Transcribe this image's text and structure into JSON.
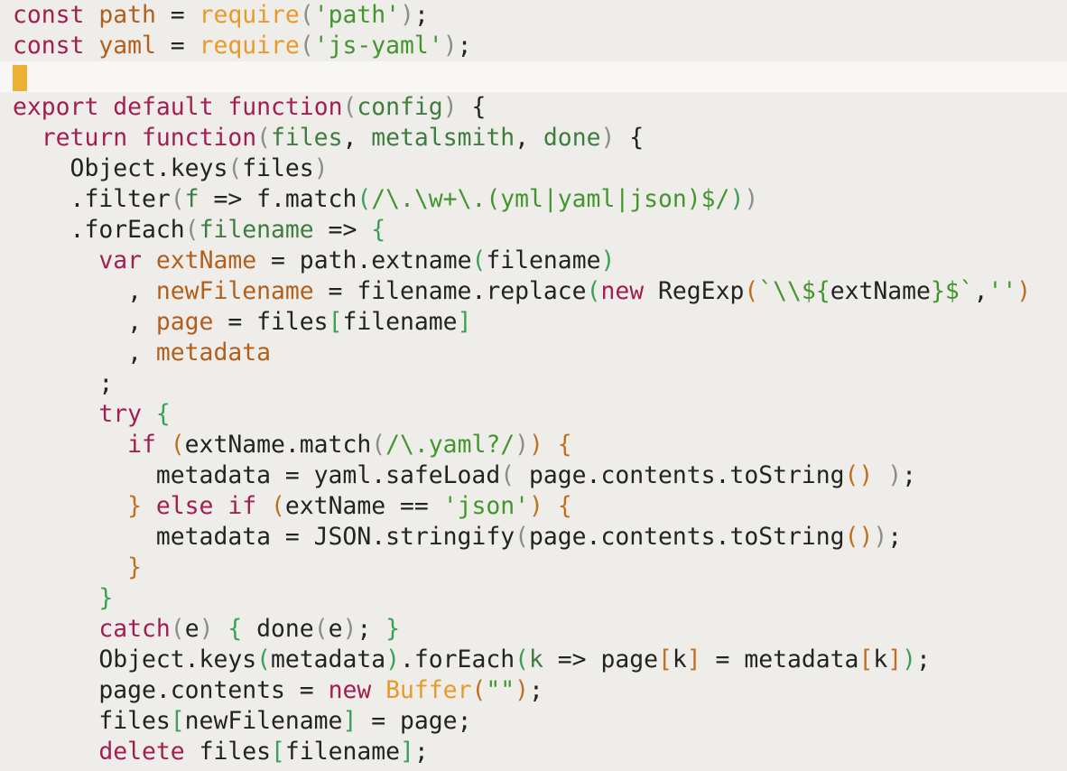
{
  "editor": {
    "cursor_line": 3,
    "colors": {
      "background": "#efedea",
      "current_line": "#f8f7f5",
      "cursor": "#eeb032",
      "keyword": "#a21e52",
      "declaration": "#b15f1c",
      "function_call": "#e89a29",
      "string": "#42962d",
      "parameter": "#3e7d3d",
      "text": "#232323",
      "paren_gray": "#8c8c8c",
      "paren_green": "#3aa055",
      "paren_orange": "#c06f1e"
    },
    "lines": [
      [
        [
          "kw",
          "const"
        ],
        [
          "txt",
          " "
        ],
        [
          "def",
          "path"
        ],
        [
          "txt",
          " = "
        ],
        [
          "fn",
          "require"
        ],
        [
          "pg",
          "("
        ],
        [
          "str",
          "'path'"
        ],
        [
          "pg",
          ")"
        ],
        [
          "txt",
          ";"
        ]
      ],
      [
        [
          "kw",
          "const"
        ],
        [
          "txt",
          " "
        ],
        [
          "def",
          "yaml"
        ],
        [
          "txt",
          " = "
        ],
        [
          "fn",
          "require"
        ],
        [
          "pg",
          "("
        ],
        [
          "str",
          "'js-yaml'"
        ],
        [
          "pg",
          ")"
        ],
        [
          "txt",
          ";"
        ]
      ],
      [],
      [
        [
          "kw",
          "export"
        ],
        [
          "txt",
          " "
        ],
        [
          "kw",
          "default"
        ],
        [
          "txt",
          " "
        ],
        [
          "kw",
          "function"
        ],
        [
          "pg",
          "("
        ],
        [
          "prm",
          "config"
        ],
        [
          "pg",
          ")"
        ],
        [
          "txt",
          " "
        ],
        [
          "pun",
          "{"
        ]
      ],
      [
        [
          "txt",
          "  "
        ],
        [
          "kw",
          "return"
        ],
        [
          "txt",
          " "
        ],
        [
          "kw",
          "function"
        ],
        [
          "pg",
          "("
        ],
        [
          "prm",
          "files"
        ],
        [
          "txt",
          ", "
        ],
        [
          "prm",
          "metalsmith"
        ],
        [
          "txt",
          ", "
        ],
        [
          "prm",
          "done"
        ],
        [
          "pg",
          ")"
        ],
        [
          "txt",
          " "
        ],
        [
          "pun",
          "{"
        ]
      ],
      [
        [
          "txt",
          "    Object.keys"
        ],
        [
          "pg",
          "("
        ],
        [
          "txt",
          "files"
        ],
        [
          "pg",
          ")"
        ]
      ],
      [
        [
          "txt",
          "    .filter"
        ],
        [
          "pg",
          "("
        ],
        [
          "prm",
          "f"
        ],
        [
          "txt",
          " => f.match"
        ],
        [
          "pgr",
          "("
        ],
        [
          "str",
          "/\\.\\w+\\.(yml|yaml|json)$/"
        ],
        [
          "pgr",
          ")"
        ],
        [
          "pg",
          ")"
        ]
      ],
      [
        [
          "txt",
          "    .forEach"
        ],
        [
          "pg",
          "("
        ],
        [
          "prm",
          "filename"
        ],
        [
          "txt",
          " => "
        ],
        [
          "pgr",
          "{"
        ]
      ],
      [
        [
          "txt",
          "      "
        ],
        [
          "kw",
          "var"
        ],
        [
          "txt",
          " "
        ],
        [
          "def",
          "extName"
        ],
        [
          "txt",
          " = path.extname"
        ],
        [
          "pgr",
          "("
        ],
        [
          "txt",
          "filename"
        ],
        [
          "pgr",
          ")"
        ]
      ],
      [
        [
          "txt",
          "        , "
        ],
        [
          "def",
          "newFilename"
        ],
        [
          "txt",
          " = filename.replace"
        ],
        [
          "pgr",
          "("
        ],
        [
          "kw",
          "new"
        ],
        [
          "txt",
          " RegExp"
        ],
        [
          "por",
          "("
        ],
        [
          "str",
          "`\\\\${"
        ],
        [
          "txt",
          "extName"
        ],
        [
          "str",
          "}$`"
        ],
        [
          "txt",
          ","
        ],
        [
          "str",
          "''"
        ],
        [
          "por",
          ")"
        ]
      ],
      [
        [
          "txt",
          "        , "
        ],
        [
          "def",
          "page"
        ],
        [
          "txt",
          " = files"
        ],
        [
          "pgr",
          "["
        ],
        [
          "txt",
          "filename"
        ],
        [
          "pgr",
          "]"
        ]
      ],
      [
        [
          "txt",
          "        , "
        ],
        [
          "def",
          "metadata"
        ]
      ],
      [
        [
          "txt",
          "      ;"
        ]
      ],
      [
        [
          "txt",
          "      "
        ],
        [
          "kw",
          "try"
        ],
        [
          "txt",
          " "
        ],
        [
          "pgr",
          "{"
        ]
      ],
      [
        [
          "txt",
          "        "
        ],
        [
          "kw",
          "if"
        ],
        [
          "txt",
          " "
        ],
        [
          "por",
          "("
        ],
        [
          "txt",
          "extName.match"
        ],
        [
          "pg",
          "("
        ],
        [
          "str",
          "/\\.yaml?/"
        ],
        [
          "pg",
          ")"
        ],
        [
          "por",
          ")"
        ],
        [
          "txt",
          " "
        ],
        [
          "por",
          "{"
        ]
      ],
      [
        [
          "txt",
          "          metadata = yaml.safeLoad"
        ],
        [
          "pg",
          "("
        ],
        [
          "txt",
          " page.contents.toString"
        ],
        [
          "por",
          "()"
        ],
        [
          "txt",
          " "
        ],
        [
          "pg",
          ")"
        ],
        [
          "txt",
          ";"
        ]
      ],
      [
        [
          "txt",
          "        "
        ],
        [
          "por",
          "}"
        ],
        [
          "txt",
          " "
        ],
        [
          "kw",
          "else"
        ],
        [
          "txt",
          " "
        ],
        [
          "kw",
          "if"
        ],
        [
          "txt",
          " "
        ],
        [
          "por",
          "("
        ],
        [
          "txt",
          "extName == "
        ],
        [
          "str",
          "'json'"
        ],
        [
          "por",
          ")"
        ],
        [
          "txt",
          " "
        ],
        [
          "por",
          "{"
        ]
      ],
      [
        [
          "txt",
          "          metadata = JSON.stringify"
        ],
        [
          "pg",
          "("
        ],
        [
          "txt",
          "page.contents.toString"
        ],
        [
          "por",
          "()"
        ],
        [
          "pg",
          ")"
        ],
        [
          "txt",
          ";"
        ]
      ],
      [
        [
          "txt",
          "        "
        ],
        [
          "por",
          "}"
        ]
      ],
      [
        [
          "txt",
          "      "
        ],
        [
          "pgr",
          "}"
        ]
      ],
      [
        [
          "txt",
          "      "
        ],
        [
          "kw",
          "catch"
        ],
        [
          "pg",
          "("
        ],
        [
          "txt",
          "e"
        ],
        [
          "pg",
          ")"
        ],
        [
          "txt",
          " "
        ],
        [
          "pgr",
          "{"
        ],
        [
          "txt",
          " done"
        ],
        [
          "pg",
          "("
        ],
        [
          "txt",
          "e"
        ],
        [
          "pg",
          ")"
        ],
        [
          "txt",
          "; "
        ],
        [
          "pgr",
          "}"
        ]
      ],
      [
        [
          "txt",
          "      Object.keys"
        ],
        [
          "pgr",
          "("
        ],
        [
          "txt",
          "metadata"
        ],
        [
          "pgr",
          ")"
        ],
        [
          "txt",
          ".forEach"
        ],
        [
          "pgr",
          "("
        ],
        [
          "prm",
          "k"
        ],
        [
          "txt",
          " => page"
        ],
        [
          "por",
          "["
        ],
        [
          "txt",
          "k"
        ],
        [
          "por",
          "]"
        ],
        [
          "txt",
          " = metadata"
        ],
        [
          "por",
          "["
        ],
        [
          "txt",
          "k"
        ],
        [
          "por",
          "]"
        ],
        [
          "pgr",
          ")"
        ],
        [
          "txt",
          ";"
        ]
      ],
      [
        [
          "txt",
          "      page.contents = "
        ],
        [
          "kw",
          "new"
        ],
        [
          "txt",
          " "
        ],
        [
          "fn",
          "Buffer"
        ],
        [
          "por",
          "("
        ],
        [
          "str",
          "\"\""
        ],
        [
          "por",
          ")"
        ],
        [
          "txt",
          ";"
        ]
      ],
      [
        [
          "txt",
          "      files"
        ],
        [
          "pgr",
          "["
        ],
        [
          "txt",
          "newFilename"
        ],
        [
          "pgr",
          "]"
        ],
        [
          "txt",
          " = page;"
        ]
      ],
      [
        [
          "txt",
          "      "
        ],
        [
          "kw",
          "delete"
        ],
        [
          "txt",
          " files"
        ],
        [
          "pgr",
          "["
        ],
        [
          "txt",
          "filename"
        ],
        [
          "pgr",
          "]"
        ],
        [
          "txt",
          ";"
        ]
      ]
    ]
  }
}
